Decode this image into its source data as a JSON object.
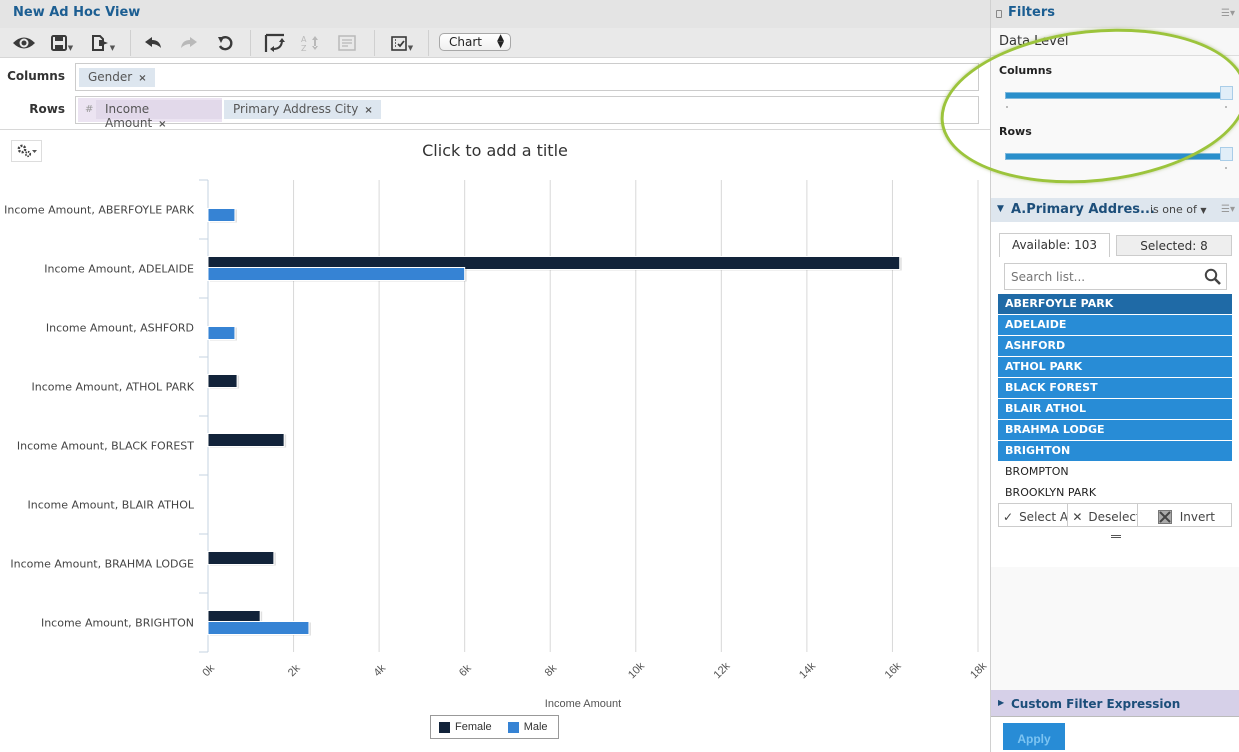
{
  "app": {
    "title": "New Ad Hoc View"
  },
  "toolbar": {
    "buttons": [
      {
        "name": "display-mode",
        "icon": "eye-icon"
      },
      {
        "name": "save",
        "icon": "save-icon",
        "has_menu": true
      },
      {
        "name": "export",
        "icon": "export-icon",
        "has_menu": true
      },
      {
        "name": "undo",
        "icon": "undo-icon"
      },
      {
        "name": "redo",
        "icon": "redo-icon",
        "disabled": true
      },
      {
        "name": "undo-all",
        "icon": "undo-all-icon"
      },
      {
        "name": "pivot",
        "icon": "pivot-icon"
      },
      {
        "name": "sort",
        "icon": "sort-az-icon",
        "disabled": true
      },
      {
        "name": "query",
        "icon": "query-icon",
        "disabled": true
      },
      {
        "name": "options",
        "icon": "checklist-icon",
        "has_menu": true
      }
    ],
    "view_type": "Chart"
  },
  "fields": {
    "columns_label": "Columns",
    "rows_label": "Rows",
    "columns": [
      {
        "label": "Gender",
        "remove": "×"
      }
    ],
    "rows": [
      {
        "label": "Income Amount",
        "remove": "×",
        "measure": true,
        "prefix": "#"
      },
      {
        "label": "Primary Address City",
        "remove": "×"
      }
    ]
  },
  "chart": {
    "title_placeholder": "Click to add a title"
  },
  "chart_data": {
    "type": "bar",
    "orientation": "horizontal",
    "title": "Click to add a title",
    "xlabel": "Income Amount",
    "ylabel": "",
    "xlim": [
      0,
      18000
    ],
    "x_ticks": [
      "0k",
      "2k",
      "4k",
      "6k",
      "8k",
      "10k",
      "12k",
      "14k",
      "16k",
      "18k"
    ],
    "x_tick_values": [
      0,
      2000,
      4000,
      6000,
      8000,
      10000,
      12000,
      14000,
      16000,
      18000
    ],
    "grid": true,
    "legend_position": "bottom",
    "categories": [
      "Income Amount, ABERFOYLE PARK",
      "Income Amount, ADELAIDE",
      "Income Amount, ASHFORD",
      "Income Amount, ATHOL PARK",
      "Income Amount, BLACK FOREST",
      "Income Amount, BLAIR ATHOL",
      "Income Amount, BRAHMA LODGE",
      "Income Amount, BRIGHTON"
    ],
    "series": [
      {
        "name": "Female",
        "color": "#12233a",
        "values": [
          null,
          16170,
          null,
          680,
          1780,
          null,
          1540,
          1220
        ]
      },
      {
        "name": "Male",
        "color": "#3683d4",
        "values": [
          630,
          6000,
          630,
          null,
          null,
          null,
          null,
          2360
        ]
      }
    ]
  },
  "filters": {
    "title": "Filters",
    "data_level": {
      "label": "Data Level",
      "columns_label": "Columns",
      "rows_label": "Rows",
      "columns_level": 1.0,
      "rows_level": 1.0
    },
    "filter": {
      "name": "A.Primary Addres...",
      "operator": "is one of",
      "tab_available": "Available: 103",
      "tab_selected": "Selected: 8",
      "search_placeholder": "Search list...",
      "items": [
        {
          "label": "ABERFOYLE PARK",
          "selected": true
        },
        {
          "label": "ADELAIDE",
          "selected": true
        },
        {
          "label": "ASHFORD",
          "selected": true
        },
        {
          "label": "ATHOL PARK",
          "selected": true
        },
        {
          "label": "BLACK FOREST",
          "selected": true
        },
        {
          "label": "BLAIR ATHOL",
          "selected": true
        },
        {
          "label": "BRAHMA LODGE",
          "selected": true
        },
        {
          "label": "BRIGHTON",
          "selected": true
        },
        {
          "label": "BROMPTON",
          "selected": false
        },
        {
          "label": "BROOKLYN PARK",
          "selected": false
        }
      ],
      "actions": {
        "select_all": "Select A",
        "deselect": "Deselect",
        "invert": "Invert"
      }
    },
    "custom_expression_label": "Custom Filter Expression",
    "apply_label": "Apply"
  },
  "colors": {
    "brand_title": "#1c5e92",
    "selection": "#288cd6",
    "female": "#12233a",
    "male": "#3683d4",
    "annotation": "#9cc43c"
  }
}
